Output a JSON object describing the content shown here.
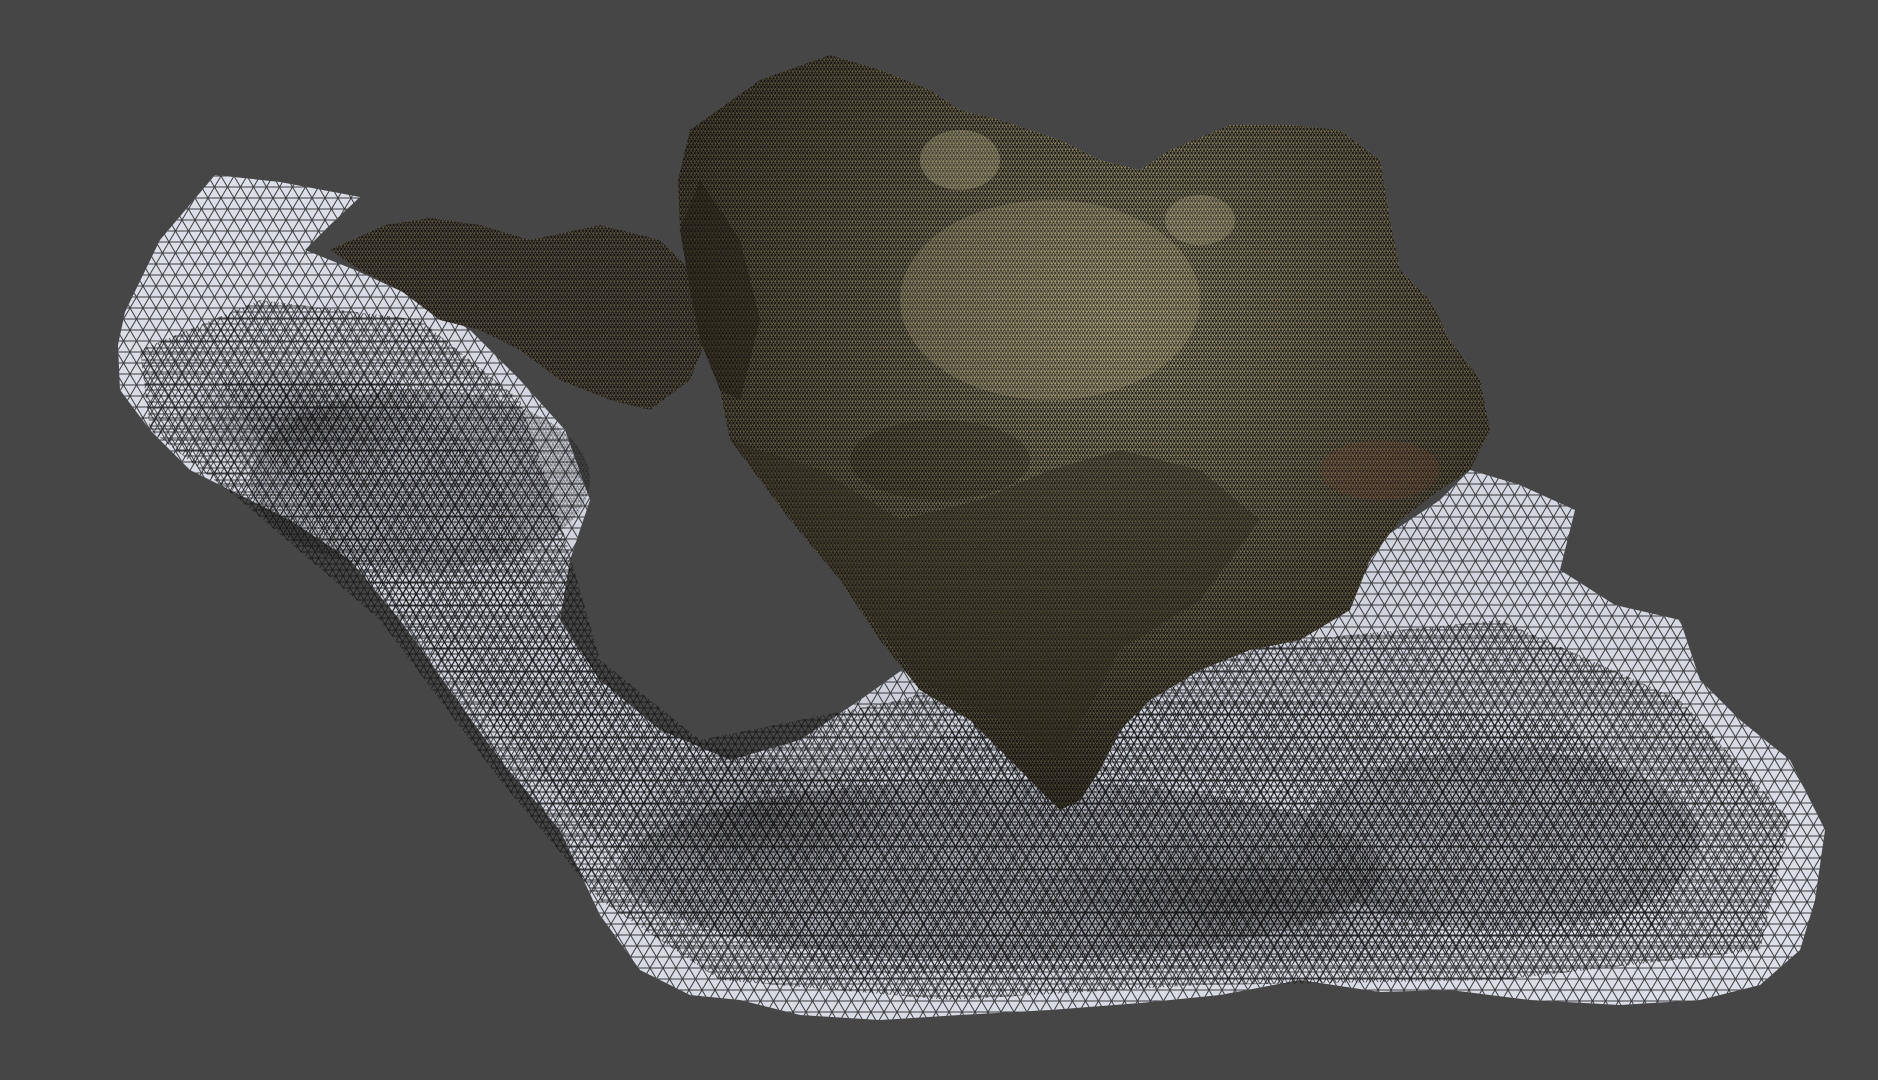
{
  "viewport": {
    "background_color": "#464646",
    "object": "scanned-rock-mesh",
    "display_mode": "wireframe-over-textured"
  },
  "mesh": {
    "ground_color": "#d2d4df",
    "rock_color": "#6b644c",
    "rock_highlight_color": "#aaa27a",
    "wire_color": "#101010"
  }
}
